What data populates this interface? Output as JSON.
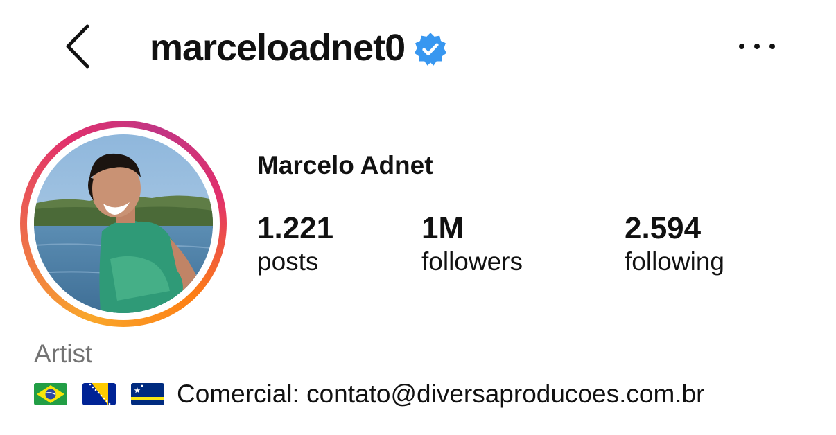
{
  "header": {
    "username": "marceloadnet0",
    "back_icon": "chevron-left-icon",
    "verified_icon": "verified-badge-icon",
    "more_icon": "more-horizontal-icon"
  },
  "profile": {
    "display_name": "Marcelo Adnet",
    "avatar_ring_colors": [
      "#f9a72b",
      "#e1306c",
      "#c13584"
    ]
  },
  "stats": [
    {
      "value": "1.221",
      "label": "posts"
    },
    {
      "value": "1M",
      "label": "followers"
    },
    {
      "value": "2.594",
      "label": "following"
    }
  ],
  "bio": {
    "category": "Artist",
    "flags": [
      "brazil-flag",
      "bosnia-flag",
      "curacao-flag"
    ],
    "text": "Comercial: contato@diversaproducoes.com.br"
  },
  "colors": {
    "verified": "#3897f0",
    "category_text": "#737373",
    "text": "#111111"
  }
}
